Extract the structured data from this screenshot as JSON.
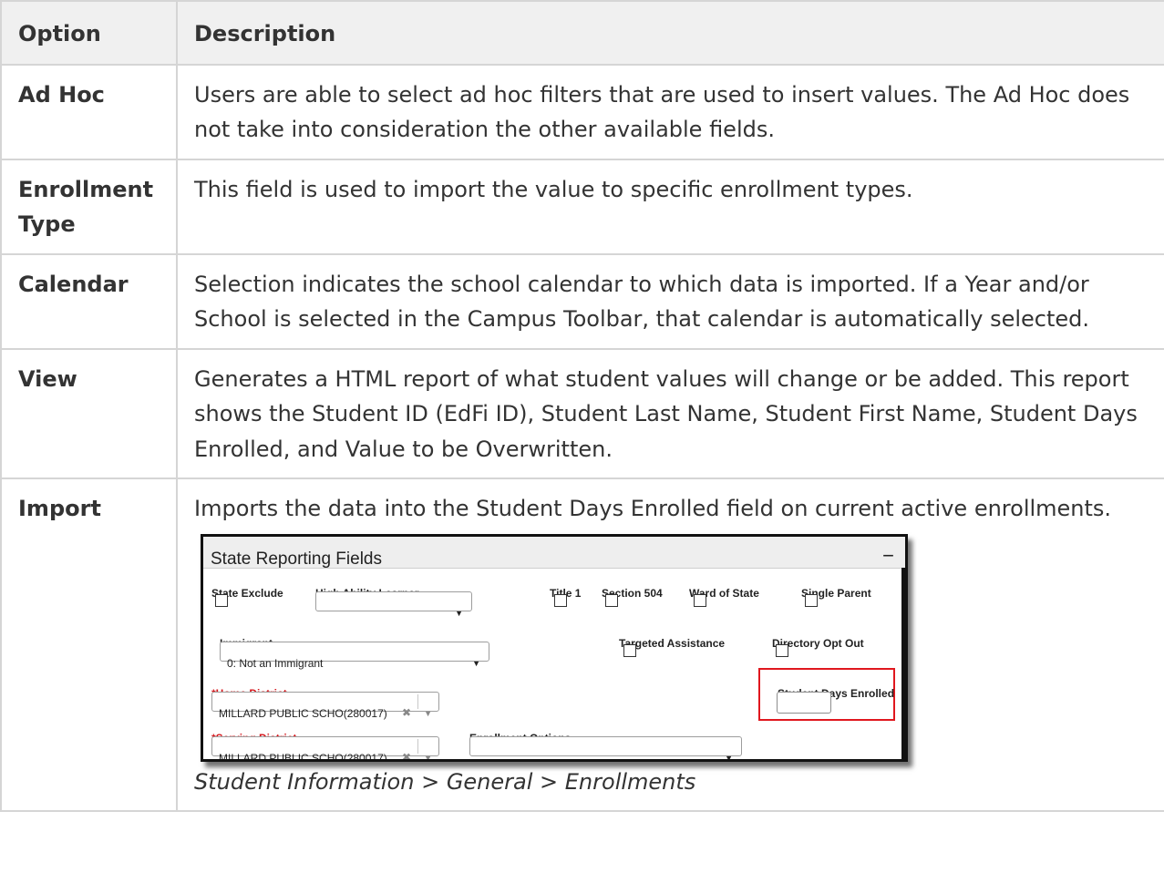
{
  "table": {
    "headers": [
      "Option",
      "Description"
    ],
    "rows": [
      {
        "option": "Ad Hoc",
        "description": "Users are able to select ad hoc filters that are used to insert values. The Ad Hoc does not take into consideration the other available fields."
      },
      {
        "option": "Enrollment Type",
        "description": "This field is used to import the value to specific enrollment types."
      },
      {
        "option": "Calendar",
        "description": "Selection indicates the school calendar to which data is imported. If a Year and/or School is selected in the Campus Toolbar, that calendar is automatically selected."
      },
      {
        "option": "View",
        "description": "Generates a HTML report of what student values will change or be added. This report shows the Student ID (EdFi ID), Student Last Name, Student First Name, Student Days Enrolled, and Value to be Overwritten."
      },
      {
        "option": "Import",
        "description": "Imports the data into the Student Days Enrolled field on current active enrollments."
      }
    ]
  },
  "screenshot": {
    "panel_title": "State Reporting Fields",
    "minimize_glyph": "−",
    "fields": {
      "state_exclude": "State Exclude",
      "high_ability_learner": "High Ability Learner",
      "title_1": "Title 1",
      "section_504": "Section 504",
      "ward_of_state": "Ward of State",
      "single_parent": "Single Parent",
      "immigrant": "Immigrant",
      "immigrant_value": "0: Not an Immigrant",
      "targeted_assistance": "Targeted Assistance",
      "directory_opt_out": "Directory Opt Out",
      "home_district": "*Home District",
      "home_district_value": "MILLARD PUBLIC SCHO(280017)",
      "student_days_enrolled": "Student Days Enrolled",
      "serving_district": "*Serving District",
      "serving_district_value": "MILLARD PUBLIC SCHO(280017)",
      "enrollment_options": "Enrollment Options"
    },
    "glyphs": {
      "caret": "▼",
      "clear": "✖"
    },
    "highlight_color": "#e0171e"
  },
  "caption": "Student Information > General > Enrollments"
}
